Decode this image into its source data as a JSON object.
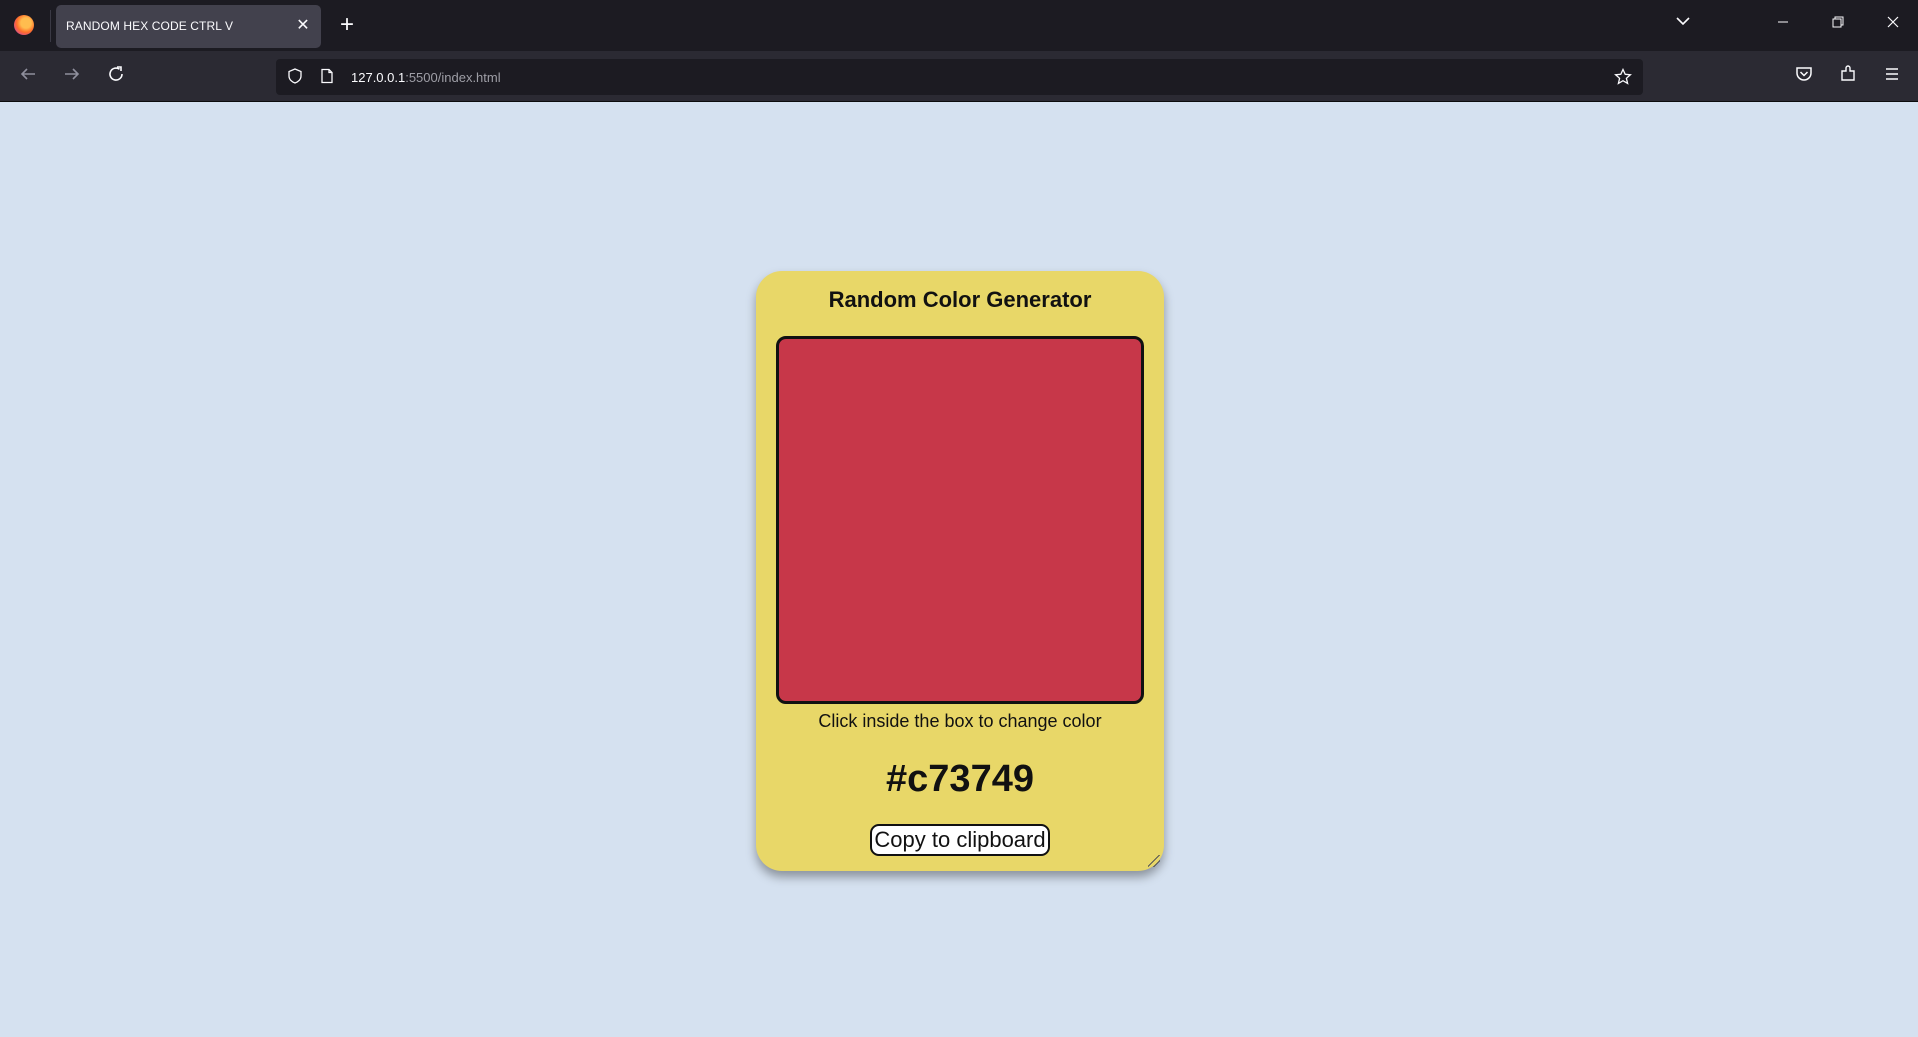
{
  "browser": {
    "tab_title": "RANDOM HEX CODE CTRL V",
    "tab_close": "✕",
    "new_tab": "+",
    "url_host": "127.0.0.1",
    "url_path": ":5500/index.html"
  },
  "icons": {
    "back": "back-arrow-icon",
    "forward": "forward-arrow-icon",
    "reload": "reload-icon",
    "shield": "shield-icon",
    "page": "page-icon",
    "star": "star-icon",
    "pocket": "pocket-icon",
    "extensions": "extensions-icon",
    "menu": "hamburger-menu-icon"
  },
  "app": {
    "title": "Random Color Generator",
    "hint": "Click inside the box to change color",
    "hex_value": "#c73749",
    "copy_label": "Copy to clipboard"
  },
  "colors": {
    "page_background": "#d5e1f0",
    "card_background": "#e8d768",
    "current_color": "#c73749"
  }
}
